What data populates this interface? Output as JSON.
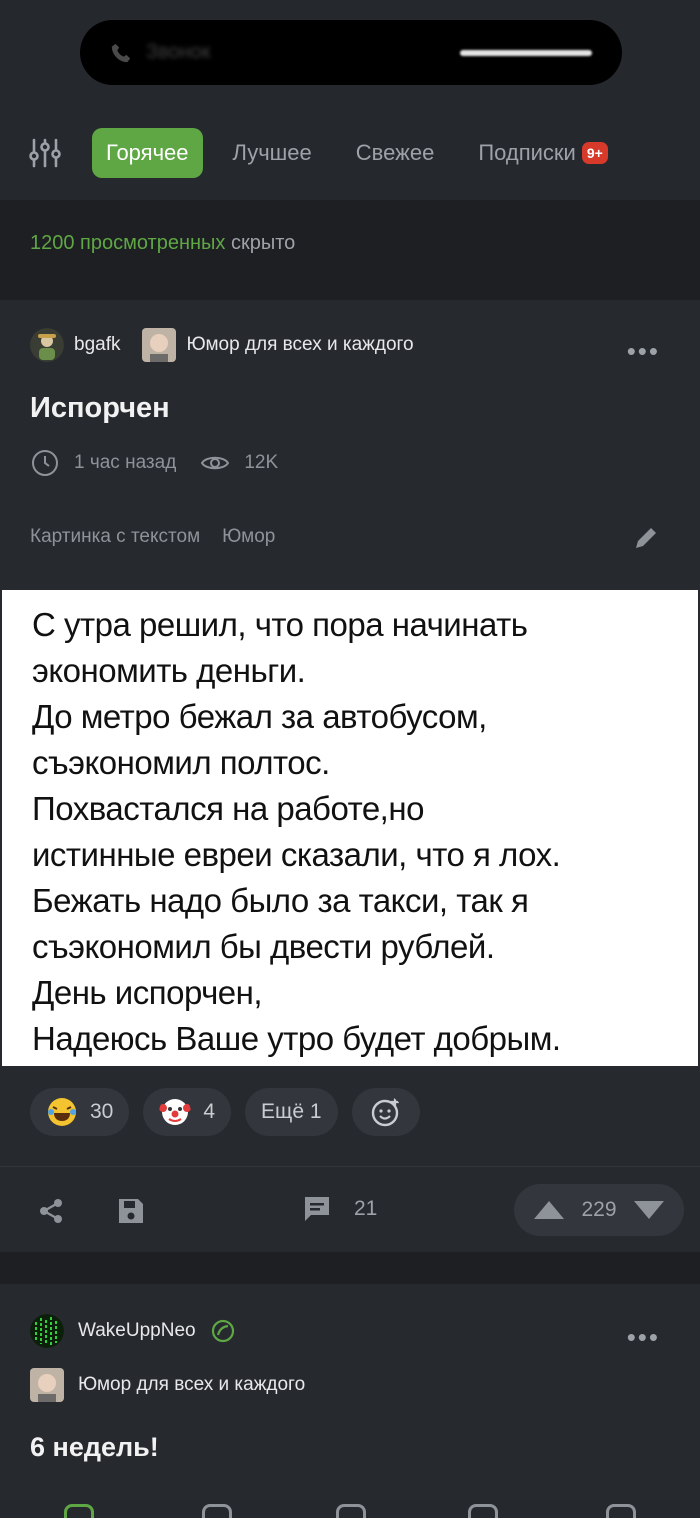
{
  "status": {
    "call_label": "Звонок"
  },
  "tabs": {
    "items": [
      {
        "label": "Горячее",
        "active": true
      },
      {
        "label": "Лучшее"
      },
      {
        "label": "Свежее"
      },
      {
        "label": "Подписки"
      }
    ],
    "subs_badge": "9+"
  },
  "viewed": {
    "count_text": "1200 просмотренных",
    "suffix": " скрыто"
  },
  "post": {
    "author": "bgafk",
    "community": "Юмор для всех и каждого",
    "title": "Испорчен",
    "time": "1 час назад",
    "views": "12K",
    "tags": [
      "Картинка с текстом",
      "Юмор"
    ],
    "image_text": [
      "С утра решил, что пора начинать",
      "экономить деньги.",
      "До метро бежал за автобусом,",
      "съэкономил полтос.",
      "Похвастался на работе,но",
      "истинные евреи сказали, что я лох.",
      "Бежать надо было за такси, так я",
      "съэкономил бы двести рублей.",
      "День  испорчен,",
      "Надеюсь Ваше утро будет добрым."
    ],
    "reactions": [
      {
        "emoji": "laughing-tears",
        "count": "30"
      },
      {
        "emoji": "clown",
        "count": "4"
      }
    ],
    "more_reactions": "Ещё 1",
    "comments": "21",
    "rating": "229"
  },
  "post2": {
    "author": "WakeUppNeo",
    "community": "Юмор для всех и каждого",
    "title": "6 недель!"
  },
  "colors": {
    "accent": "#5fa744",
    "badge": "#d73a2a",
    "bg": "#1d1f23",
    "card": "#26292e"
  }
}
